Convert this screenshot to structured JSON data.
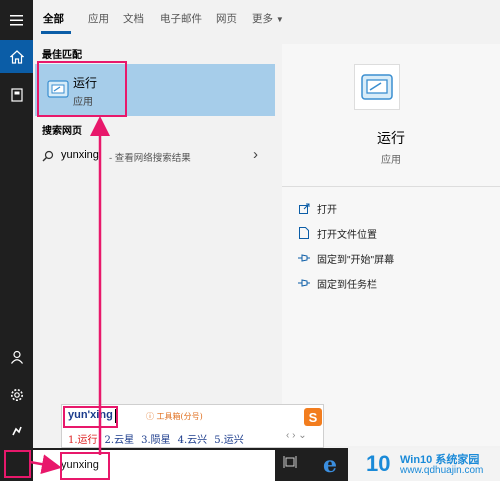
{
  "rail": {
    "menu_icon": "hamburger-menu-icon",
    "home_icon": "home-icon",
    "docs_icon": "documents-icon",
    "user_icon": "user-icon",
    "settings_icon": "gear-icon",
    "explore_icon": "explore-icon",
    "start_icon": "windows-start-icon"
  },
  "tabs": [
    "全部",
    "应用",
    "文档",
    "电子邮件",
    "网页",
    "更多"
  ],
  "best_match": {
    "section_title": "最佳匹配",
    "name": "运行",
    "type": "应用"
  },
  "web": {
    "section_title": "搜索网页",
    "query": "yunxing",
    "suffix": " - 查看网络搜索结果"
  },
  "detail": {
    "title": "运行",
    "type": "应用",
    "actions": [
      "打开",
      "打开文件位置",
      "固定到\"开始\"屏幕",
      "固定到任务栏"
    ]
  },
  "ime": {
    "composition": "yun'xing",
    "toolbox": "工具箱(分号)",
    "logo": "S",
    "candidates": [
      "1.运行",
      "2.云星",
      "3.陨星",
      "4.云兴",
      "5.运兴"
    ],
    "nav": "‹ ›  ⌄"
  },
  "search": {
    "value": "yunxing"
  },
  "watermark": {
    "logo": "10",
    "brand": "Win10 系统家园",
    "url": "www.qdhuajin.com"
  },
  "colors": {
    "accent": "#0b5da7",
    "selection": "#a6cdea",
    "highlight": "#e8186b"
  }
}
